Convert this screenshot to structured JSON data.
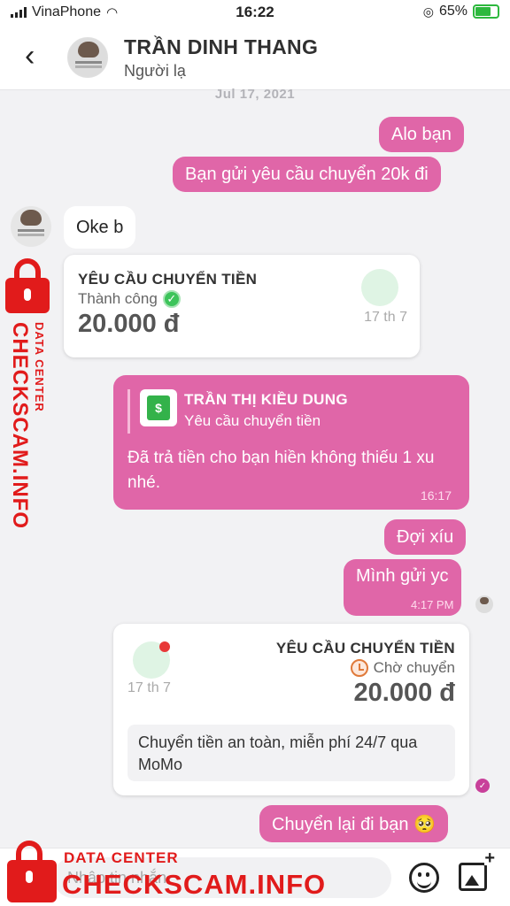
{
  "status_bar": {
    "carrier": "VinaPhone",
    "time": "16:22",
    "battery": "65%"
  },
  "header": {
    "back_icon": "chevron-left-icon",
    "name": "TRẦN DINH THANG",
    "subtitle": "Người lạ"
  },
  "date_label": "Jul 17, 2021",
  "messages": {
    "m1": "Alo bạn",
    "m2": "Bạn gửi yêu cầu chuyển 20k đi",
    "m3": "Oke b",
    "m4": "Đợi xíu",
    "m5": "Mình gửi yc",
    "m5_time": "4:17 PM",
    "m6": "Chuyển lại đi bạn 🥺"
  },
  "card1": {
    "title": "YÊU CẦU CHUYỂN TIỀN",
    "status": "Thành công",
    "amount": "20.000 đ",
    "date": "17 th 7"
  },
  "quote": {
    "name": "TRẦN THỊ KIỀU DUNG",
    "subtitle": "Yêu cầu chuyển tiền",
    "body": "Đã trả tiền cho bạn hiền không thiếu 1 xu nhé.",
    "time": "16:17"
  },
  "card2": {
    "title": "YÊU CẦU CHUYỂN TIỀN",
    "status": "Chờ chuyển",
    "amount": "20.000 đ",
    "date": "17 th 7",
    "promo": "Chuyển tiền an toàn, miễn phí 24/7 qua MoMo"
  },
  "input": {
    "placeholder": "Nhập tin nhắn"
  },
  "watermark": {
    "small": "DATA CENTER",
    "big": "CHECKSCAM.INFO"
  },
  "colors": {
    "accent": "#e066a8",
    "success": "#3cc45a",
    "watermark": "#e11b1b"
  }
}
